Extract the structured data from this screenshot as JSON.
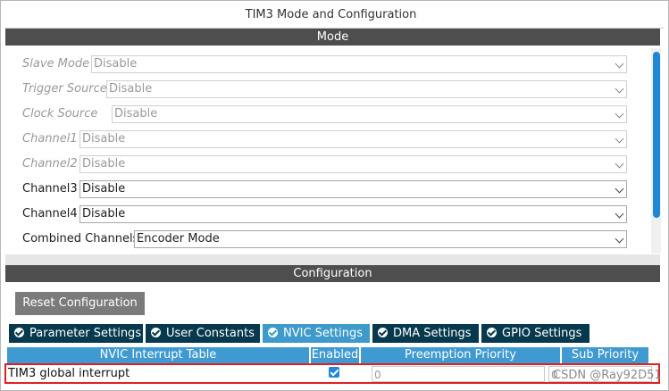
{
  "window": {
    "title": "TIM3 Mode and Configuration"
  },
  "mode": {
    "header": "Mode",
    "fields": [
      {
        "label": "Slave Mode",
        "value": "Disable",
        "enabled": false
      },
      {
        "label": "Trigger Source",
        "value": "Disable",
        "enabled": false
      },
      {
        "label": "Clock Source",
        "value": "Disable",
        "enabled": false
      },
      {
        "label": "Channel1",
        "value": "Disable",
        "enabled": false
      },
      {
        "label": "Channel2",
        "value": "Disable",
        "enabled": false
      },
      {
        "label": "Channel3",
        "value": "Disable",
        "enabled": true
      },
      {
        "label": "Channel4",
        "value": "Disable",
        "enabled": true
      },
      {
        "label": "Combined Channels",
        "value": "Encoder Mode",
        "enabled": true
      }
    ]
  },
  "configuration": {
    "header": "Configuration",
    "reset_label": "Reset Configuration",
    "tabs": [
      {
        "label": "Parameter Settings",
        "active": false,
        "icon": "check-circle-icon"
      },
      {
        "label": "User Constants",
        "active": false,
        "icon": "check-circle-icon"
      },
      {
        "label": "NVIC Settings",
        "active": true,
        "icon": "check-circle-icon"
      },
      {
        "label": "DMA Settings",
        "active": false,
        "icon": "check-circle-icon"
      },
      {
        "label": "GPIO Settings",
        "active": false,
        "icon": "check-circle-icon"
      }
    ],
    "table": {
      "columns": [
        "NVIC Interrupt Table",
        "Enabled",
        "Preemption Priority",
        "Sub Priority"
      ],
      "rows": [
        {
          "name": "TIM3 global interrupt",
          "enabled": true,
          "preemption_priority": "0",
          "sub_priority": "0"
        }
      ]
    }
  },
  "watermark": "CSDN @Ray92D51",
  "colors": {
    "section_header": "#4e4e4e",
    "tab_bg": "#07394e",
    "tab_active": "#3d9acb",
    "table_header": "#3e9ad0",
    "highlight": "#e02020",
    "accent": "#1f87d6"
  }
}
